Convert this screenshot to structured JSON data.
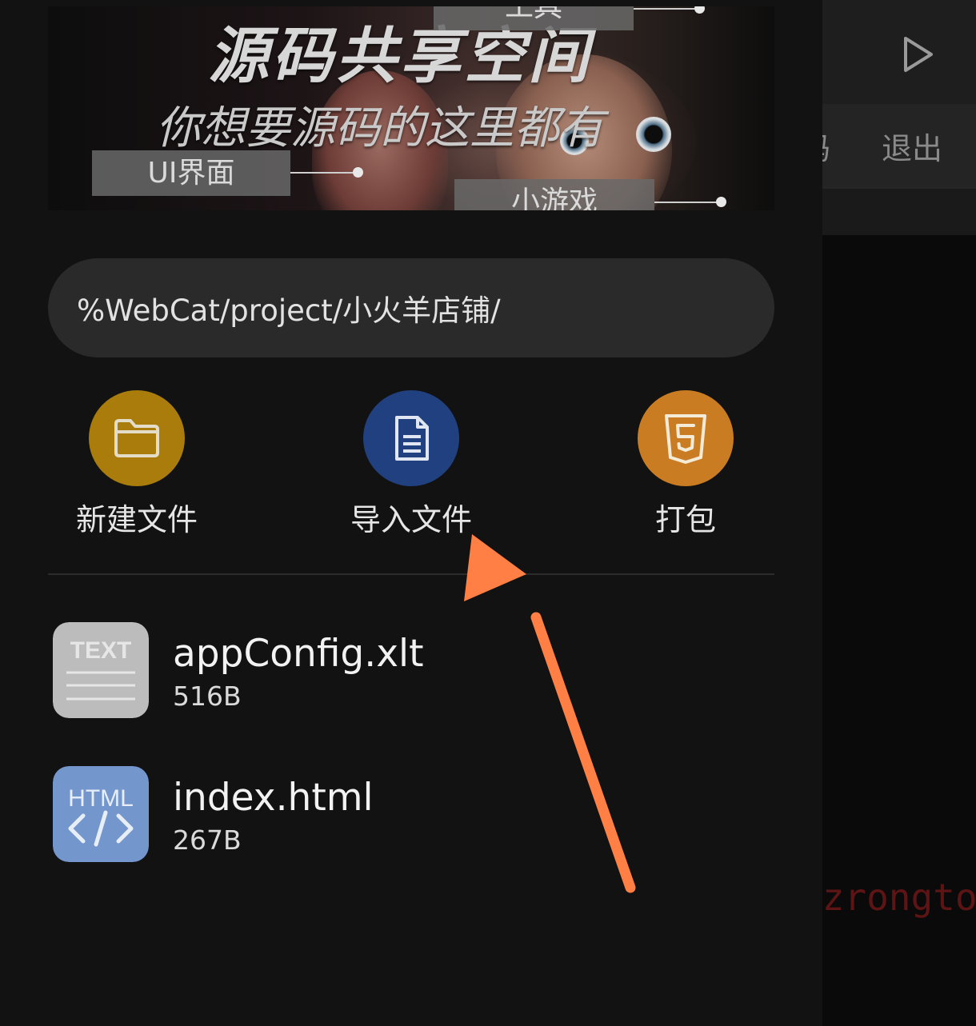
{
  "banner": {
    "title": "源码共享空间",
    "subtitle": "你想要源码的这里都有",
    "tags": {
      "tool": "工具",
      "ui": "UI界面",
      "game": "小游戏"
    }
  },
  "path": {
    "current": "%WebCat/project/小火羊店铺/"
  },
  "actions": {
    "new_file": {
      "label": "新建文件",
      "icon": "folder-icon",
      "color": "#a97c0b"
    },
    "import_file": {
      "label": "导入文件",
      "icon": "document-icon",
      "color": "#21407f"
    },
    "pack": {
      "label": "打包",
      "icon": "html5-icon",
      "color": "#c97c22"
    }
  },
  "files": [
    {
      "name": "appConfig.xlt",
      "size": "516B",
      "icon": "text-file-icon",
      "icon_text": "TEXT",
      "icon_color": "#bdbdbd"
    },
    {
      "name": "index.html",
      "size": "267B",
      "icon": "html-file-icon",
      "icon_text": "HTML",
      "icon_color": "#7396cc"
    }
  ],
  "background_editor": {
    "menu_code": "码",
    "menu_exit": "退出",
    "code_snippet": "zzrongto"
  },
  "annotation": {
    "arrow_color": "#ff7f45"
  }
}
